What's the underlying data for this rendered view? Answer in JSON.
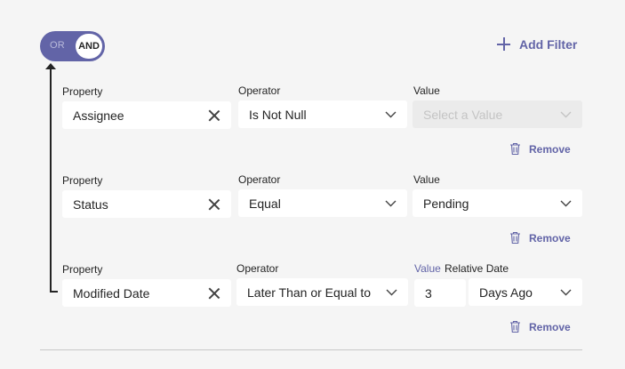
{
  "toggle": {
    "off_label": "OR",
    "on_label": "AND",
    "selected": "AND"
  },
  "add_filter": {
    "label": "Add Filter",
    "icon": "plus-icon"
  },
  "filters": [
    {
      "property_label": "Property",
      "property_value": "Assignee",
      "operator_label": "Operator",
      "operator_value": "Is Not Null",
      "value_label": "Value",
      "value_placeholder": "Select a Value",
      "value_disabled": true,
      "remove_label": "Remove"
    },
    {
      "property_label": "Property",
      "property_value": "Status",
      "operator_label": "Operator",
      "operator_value": "Equal",
      "value_label": "Value",
      "value_value": "Pending",
      "remove_label": "Remove"
    },
    {
      "property_label": "Property",
      "property_value": "Modified Date",
      "operator_label": "Operator",
      "operator_value": "Later Than or Equal to",
      "value_label": "Value",
      "relative_label": "Relative Date",
      "value_number": "3",
      "relative_value": "Days Ago",
      "remove_label": "Remove"
    }
  ],
  "colors": {
    "accent": "#6264a7",
    "background": "#f5f5f5",
    "field": "#ffffff",
    "disabled_field": "#ebebeb"
  }
}
